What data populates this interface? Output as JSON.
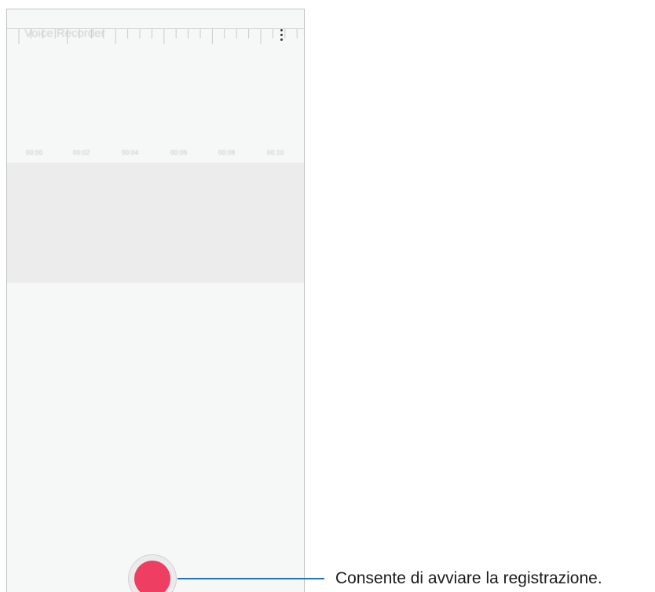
{
  "app": {
    "title": "Voice Recorder"
  },
  "header": {
    "menu_icon": "more-vertical-icon"
  },
  "timeline": {
    "labels": [
      "00:00",
      "00:02",
      "00:04",
      "00:06",
      "00:08",
      "00:10"
    ]
  },
  "controls": {
    "record_icon": "record-icon",
    "record_color": "#ee3f63"
  },
  "callout": {
    "text": "Consente di avviare la registrazione.",
    "line_color": "#1f76b8"
  }
}
